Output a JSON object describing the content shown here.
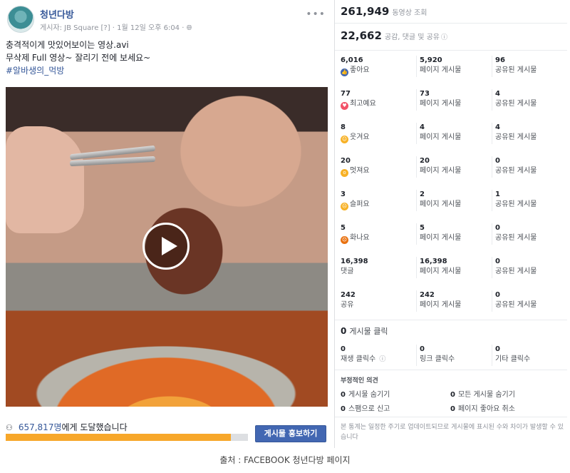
{
  "post": {
    "page_name": "청년다방",
    "meta": "게시자: JB Square [?] · 1월 12일 오후 6:04 ·",
    "caption_line1": "충격적이게 맛있어보이는 영상.avi",
    "caption_line2": "무삭제 Full 영상~ 잘리기 전에 보세요~",
    "hashtag": "#알바생의_먹방",
    "reach_count": "657,817명",
    "reach_text": "에게 도달했습니다",
    "reach_progress": 0.93,
    "promote_label": "게시물 홍보하기"
  },
  "insights": {
    "views": "261,949",
    "views_label": "동영상 조회",
    "reactions_total": "22,662",
    "reactions_label": "공감, 댓글 및 공유",
    "rows": [
      {
        "icon": "like-icon",
        "v1": "6,016",
        "l1": "좋아요",
        "v2": "5,920",
        "l2": "페이지 게시물",
        "v3": "96",
        "l3": "공유된 게시물"
      },
      {
        "icon": "love-icon",
        "v1": "77",
        "l1": "최고예요",
        "v2": "73",
        "l2": "페이지 게시물",
        "v3": "4",
        "l3": "공유된 게시물"
      },
      {
        "icon": "haha-icon",
        "v1": "8",
        "l1": "웃겨요",
        "v2": "4",
        "l2": "페이지 게시물",
        "v3": "4",
        "l3": "공유된 게시물"
      },
      {
        "icon": "wow-icon",
        "v1": "20",
        "l1": "멋져요",
        "v2": "20",
        "l2": "페이지 게시물",
        "v3": "0",
        "l3": "공유된 게시물"
      },
      {
        "icon": "sad-icon",
        "v1": "3",
        "l1": "슬퍼요",
        "v2": "2",
        "l2": "페이지 게시물",
        "v3": "1",
        "l3": "공유된 게시물"
      },
      {
        "icon": "angry-icon",
        "v1": "5",
        "l1": "화나요",
        "v2": "5",
        "l2": "페이지 게시물",
        "v3": "0",
        "l3": "공유된 게시물"
      },
      {
        "icon": "",
        "v1": "16,398",
        "l1": "댓글",
        "v2": "16,398",
        "l2": "페이지 게시물",
        "v3": "0",
        "l3": "공유된 게시물"
      },
      {
        "icon": "",
        "v1": "242",
        "l1": "공유",
        "v2": "242",
        "l2": "페이지 게시물",
        "v3": "0",
        "l3": "공유된 게시물"
      }
    ],
    "post_clicks": "0",
    "post_clicks_label": "게시물 클릭",
    "clicks": [
      {
        "v": "0",
        "l": "재생 클릭수"
      },
      {
        "v": "0",
        "l": "링크 클릭수"
      },
      {
        "v": "0",
        "l": "기타 클릭수"
      }
    ],
    "negative_title": "부정적인 의견",
    "negative": [
      {
        "v": "0",
        "l": "게시물 숨기기"
      },
      {
        "v": "0",
        "l": "모든 게시물 숨기기"
      },
      {
        "v": "0",
        "l": "스팸으로 신고"
      },
      {
        "v": "0",
        "l": "페이지 좋아요 취소"
      }
    ],
    "note": "본 통계는 일정한 주기로 업데이트되므로 게시물에 표시된 수와 차이가 발생할 수 있습니다"
  },
  "source": "출처 : FACEBOOK 청년다방 페이지"
}
